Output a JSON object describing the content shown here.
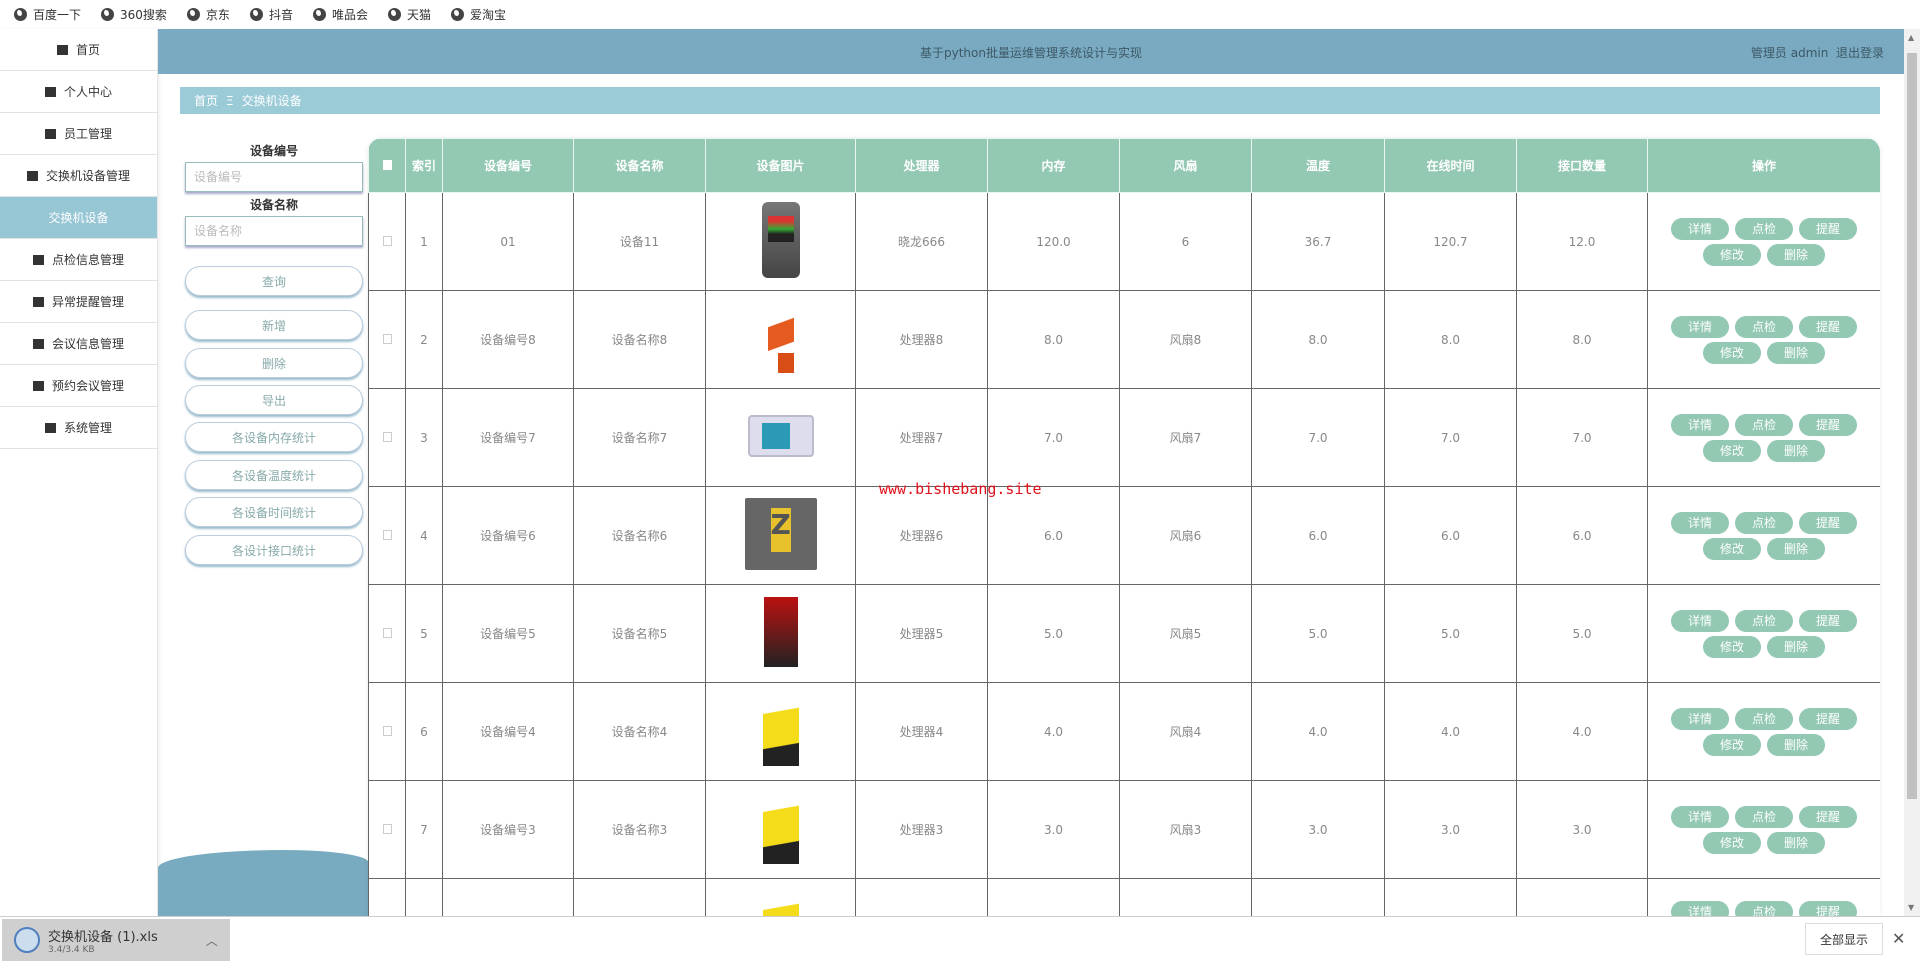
{
  "bookmarks": [
    "百度一下",
    "360搜索",
    "京东",
    "抖音",
    "唯品会",
    "天猫",
    "爱淘宝"
  ],
  "sidebar": {
    "items": [
      {
        "label": "首页",
        "icon": "home-icon"
      },
      {
        "label": "个人中心",
        "icon": "user-icon"
      },
      {
        "label": "员工管理",
        "icon": "list-icon"
      },
      {
        "label": "交换机设备管理",
        "icon": "briefcase-icon"
      },
      {
        "label": "交换机设备",
        "icon": "",
        "active": true
      },
      {
        "label": "点检信息管理",
        "icon": "ticket-icon"
      },
      {
        "label": "异常提醒管理",
        "icon": "grid-icon"
      },
      {
        "label": "会议信息管理",
        "icon": "flag-icon"
      },
      {
        "label": "预约会议管理",
        "icon": "wallet-icon"
      },
      {
        "label": "系统管理",
        "icon": "grid-icon"
      }
    ]
  },
  "header": {
    "title": "基于python批量运维管理系统设计与实现",
    "user": "管理员 admin",
    "logout": "退出登录"
  },
  "breadcrumb": {
    "home": "首页",
    "sep": "Ξ",
    "current": "交换机设备"
  },
  "search": {
    "label1": "设备编号",
    "placeholder1": "设备编号",
    "label2": "设备名称",
    "placeholder2": "设备名称",
    "buttons": [
      "查询",
      "新增",
      "删除",
      "导出",
      "各设备内存统计",
      "各设备温度统计",
      "各设备时间统计",
      "各设计接口统计"
    ]
  },
  "table": {
    "headers": [
      "索引",
      "设备编号",
      "设备名称",
      "设备图片",
      "处理器",
      "内存",
      "风扇",
      "温度",
      "在线时间",
      "接口数量",
      "操作"
    ],
    "actions": [
      "详情",
      "点检",
      "提醒",
      "修改",
      "删除"
    ],
    "rows": [
      {
        "idx": "1",
        "code": "01",
        "name": "设备11",
        "img": "recorder",
        "cpu": "晓龙666",
        "mem": "120.0",
        "fan": "6",
        "temp": "36.7",
        "online": "120.7",
        "ports": "12.0"
      },
      {
        "idx": "2",
        "code": "设备编号8",
        "name": "设备名称8",
        "img": "orange",
        "cpu": "处理器8",
        "mem": "8.0",
        "fan": "风扇8",
        "temp": "8.0",
        "online": "8.0",
        "ports": "8.0"
      },
      {
        "idx": "3",
        "code": "设备编号7",
        "name": "设备名称7",
        "img": "panel",
        "cpu": "处理器7",
        "mem": "7.0",
        "fan": "风扇7",
        "temp": "7.0",
        "online": "7.0",
        "ports": "7.0"
      },
      {
        "idx": "4",
        "code": "设备编号6",
        "name": "设备名称6",
        "img": "comp",
        "cpu": "处理器6",
        "mem": "6.0",
        "fan": "风扇6",
        "temp": "6.0",
        "online": "6.0",
        "ports": "6.0"
      },
      {
        "idx": "5",
        "code": "设备编号5",
        "name": "设备名称5",
        "img": "red",
        "cpu": "处理器5",
        "mem": "5.0",
        "fan": "风扇5",
        "temp": "5.0",
        "online": "5.0",
        "ports": "5.0"
      },
      {
        "idx": "6",
        "code": "设备编号4",
        "name": "设备名称4",
        "img": "yellow",
        "cpu": "处理器4",
        "mem": "4.0",
        "fan": "风扇4",
        "temp": "4.0",
        "online": "4.0",
        "ports": "4.0"
      },
      {
        "idx": "7",
        "code": "设备编号3",
        "name": "设备名称3",
        "img": "yellow",
        "cpu": "处理器3",
        "mem": "3.0",
        "fan": "风扇3",
        "temp": "3.0",
        "online": "3.0",
        "ports": "3.0"
      },
      {
        "idx": "",
        "code": "",
        "name": "",
        "img": "yellow",
        "cpu": "",
        "mem": "",
        "fan": "",
        "temp": "",
        "online": "",
        "ports": ""
      }
    ]
  },
  "watermark": "www.bishebang.site",
  "download": {
    "filename": "交换机设备 (1).xls",
    "size": "3.4/3.4 KB",
    "show_all": "全部显示"
  }
}
